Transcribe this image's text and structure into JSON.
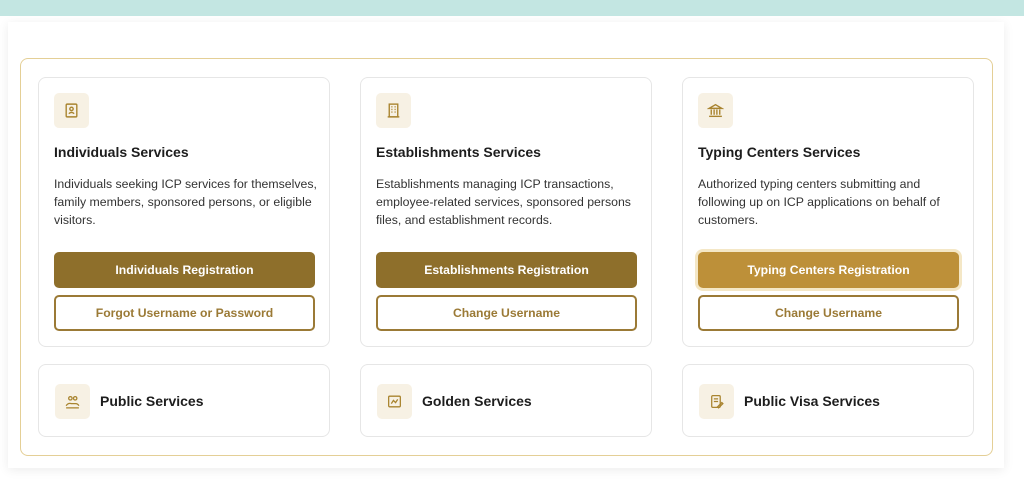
{
  "colors": {
    "accent_dark": "#8e6f2b",
    "accent_light": "#bd9039",
    "frame": "#e4cf96",
    "top_band": "#c3e6e2"
  },
  "cards": [
    {
      "icon": "id-card-icon",
      "title": "Individuals Services",
      "description": "Individuals seeking ICP services for themselves, family members, sponsored persons, or eligible visitors.",
      "primary_label": "Individuals Registration",
      "secondary_label": "Forgot Username or Password"
    },
    {
      "icon": "building-icon",
      "title": "Establishments Services",
      "description": "Establishments managing ICP transactions, employee-related services, sponsored persons files, and establishment records.",
      "primary_label": "Establishments Registration",
      "secondary_label": "Change Username"
    },
    {
      "icon": "bank-icon",
      "title": "Typing Centers Services",
      "description": "Authorized typing centers submitting and following up on ICP applications on behalf of customers.",
      "primary_label": "Typing Centers Registration",
      "secondary_label": "Change Username"
    }
  ],
  "small_cards": [
    {
      "icon": "people-hand-icon",
      "title": "Public Services"
    },
    {
      "icon": "golden-card-icon",
      "title": "Golden Services"
    },
    {
      "icon": "visa-document-icon",
      "title": "Public Visa Services"
    }
  ]
}
